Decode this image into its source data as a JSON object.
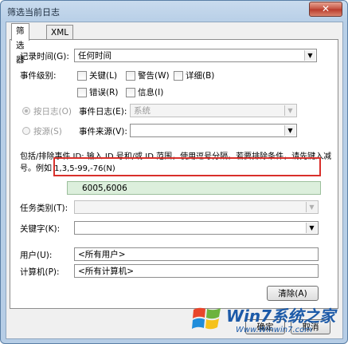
{
  "window": {
    "title": "筛选当前日志",
    "close_symbol": "✕"
  },
  "tabs": [
    {
      "label": "筛选器"
    },
    {
      "label": "XML"
    }
  ],
  "filter": {
    "logged_label": "记录时间(G):",
    "logged_value": "任何时间",
    "event_level_label": "事件级别:",
    "levels": [
      {
        "label": "关键(L)"
      },
      {
        "label": "警告(W)"
      },
      {
        "label": "详细(B)"
      },
      {
        "label": "错误(R)"
      },
      {
        "label": "信息(I)"
      }
    ],
    "by_log_label": "按日志(O)",
    "event_logs_label": "事件日志(E):",
    "event_logs_value": "系统",
    "by_source_label": "按源(S)",
    "event_sources_label": "事件来源(V):",
    "event_sources_value": "",
    "id_instructions_line1": "包括/排除事件 ID: 输入 ID 号和/或 ID 范围，使用逗号分隔。若要排除条件，请先键入减",
    "id_instructions_line2": "号。例如 1,3,5-99,-76(N)",
    "event_ids_value": "6005,6006",
    "task_category_label": "任务类别(T):",
    "task_category_value": "",
    "keywords_label": "关键字(K):",
    "keywords_value": "",
    "user_label": "用户(U):",
    "user_value": "<所有用户>",
    "computer_label": "计算机(P):",
    "computer_value": "<所有计算机>",
    "clear_label": "清除(A)"
  },
  "footer": {
    "ok_label": "确定",
    "cancel_label": "取消"
  },
  "watermark": {
    "brand": "Win7系统之家",
    "url": "Www.Winwin7.com"
  },
  "colors": {
    "highlight_border": "#d9302b",
    "id_field_bg": "#dcefdc"
  }
}
